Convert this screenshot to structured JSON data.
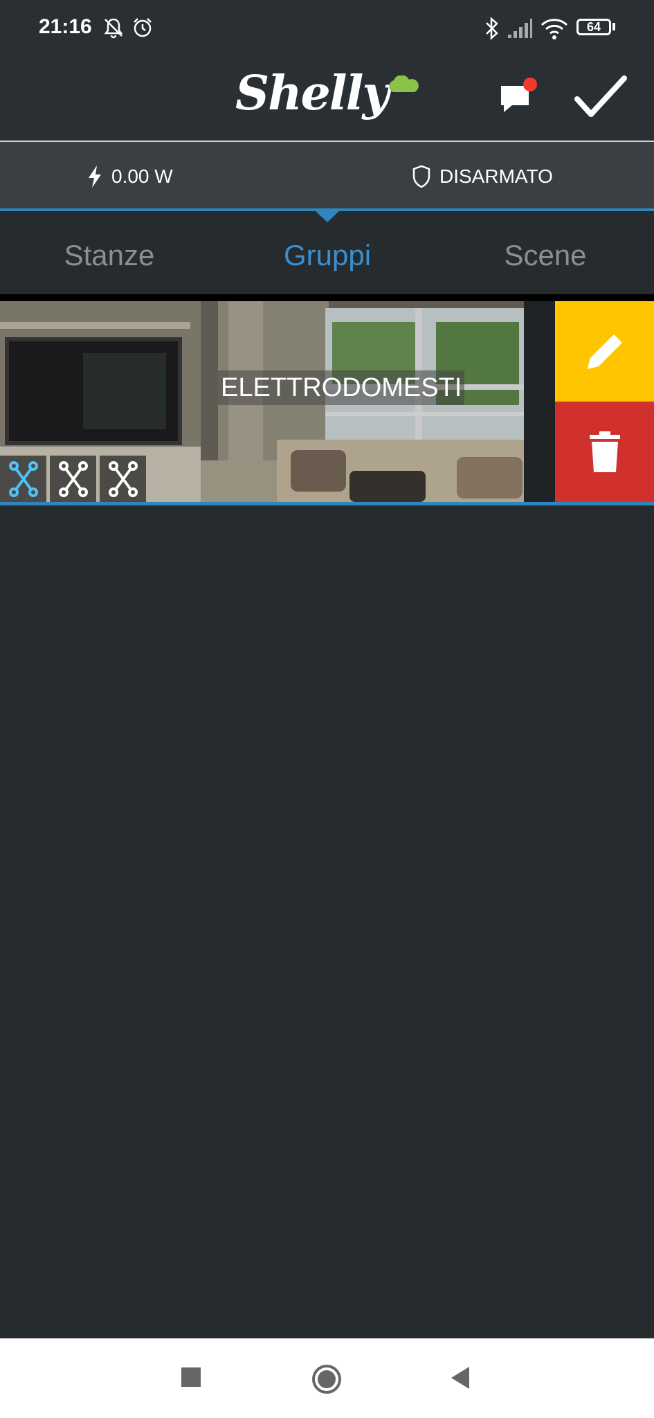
{
  "status_bar": {
    "time": "21:16",
    "icons": [
      "bell-off-icon",
      "alarm-icon",
      "bluetooth-icon",
      "signal-icon",
      "wifi-icon",
      "battery-icon"
    ],
    "battery": "64"
  },
  "header": {
    "logo_text": "Shelly",
    "notification_badge_color": "#f03a2e",
    "confirm_icon": "check-icon"
  },
  "info_bar": {
    "power": "0.00 W",
    "alarm_status": "DISARMATO"
  },
  "tabs": [
    {
      "label": "Stanze",
      "active": false
    },
    {
      "label": "Gruppi",
      "active": true
    },
    {
      "label": "Scene",
      "active": false
    }
  ],
  "groups": [
    {
      "name": "ELETTRODOMESTI",
      "device_icons": [
        "device-active-icon",
        "device-icon",
        "device-icon"
      ],
      "actions": {
        "edit": "pencil-icon",
        "delete": "trash-icon"
      }
    }
  ],
  "colors": {
    "accent": "#2e86c1",
    "edit": "#ffc600",
    "delete": "#d0312d",
    "background": "#262b2e"
  },
  "nav_bar": [
    "recent-apps-icon",
    "home-icon",
    "back-icon"
  ]
}
